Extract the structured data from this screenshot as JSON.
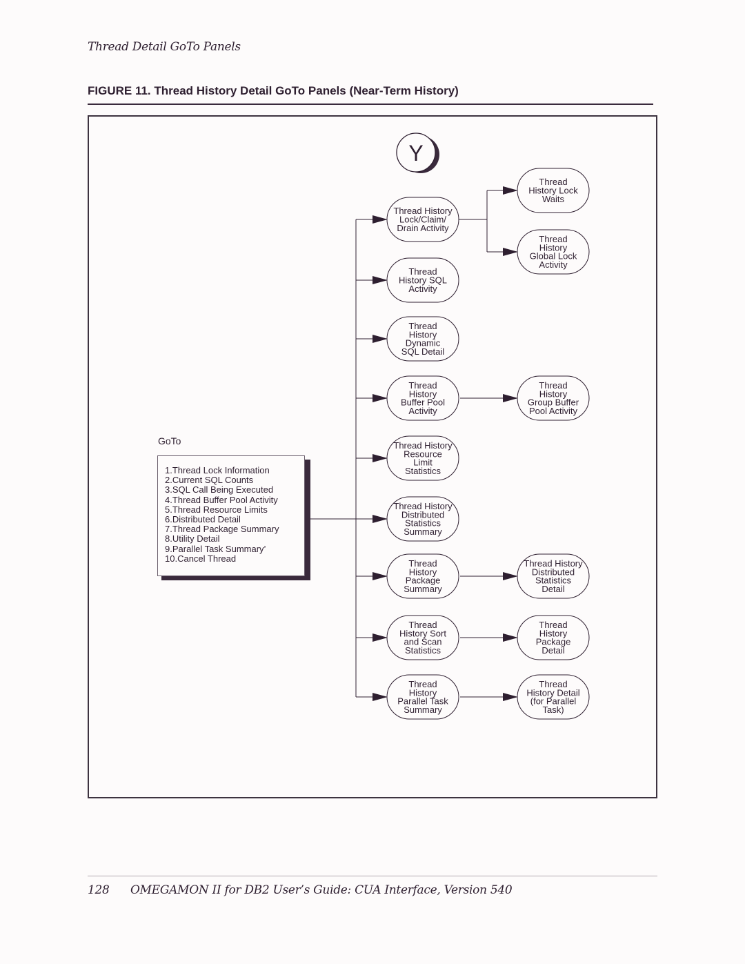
{
  "running_head": "Thread Detail GoTo Panels",
  "figure_title": "FIGURE 11.  Thread History Detail GoTo Panels (Near-Term History)",
  "start_node": {
    "label": "Y"
  },
  "goto_menu": {
    "title": "GoTo",
    "items": [
      {
        "num": "1.",
        "label": "Thread Lock Information"
      },
      {
        "num": "2.",
        "label": "Current SQL Counts"
      },
      {
        "num": "3.",
        "label": "SQL Call Being Executed"
      },
      {
        "num": "4.",
        "label": "Thread Buffer Pool Activity"
      },
      {
        "num": "5.",
        "label": "Thread Resource Limits"
      },
      {
        "num": "6.",
        "label": "Distributed Detail"
      },
      {
        "num": "7.",
        "label": "Thread Package Summary"
      },
      {
        "num": "8.",
        "label": "Utility Detail"
      },
      {
        "num": "9.",
        "label": "Parallel Task Summary’"
      },
      {
        "num": "10.",
        "label": "Cancel Thread"
      }
    ]
  },
  "panels": [
    {
      "id": "lock-claim-drain",
      "lines": [
        "Thread History",
        "Lock/Claim/",
        "Drain Activity"
      ],
      "children": [
        {
          "id": "lock-waits",
          "lines": [
            "Thread",
            "History Lock",
            "Waits"
          ]
        },
        {
          "id": "global-lock",
          "lines": [
            "Thread",
            "History",
            "Global Lock",
            "Activity"
          ]
        }
      ]
    },
    {
      "id": "sql-activity",
      "lines": [
        "Thread",
        "History SQL",
        "Activity"
      ],
      "children": []
    },
    {
      "id": "dynamic-sql",
      "lines": [
        "Thread",
        "History",
        "Dynamic",
        "SQL Detail"
      ],
      "children": []
    },
    {
      "id": "buffer-pool",
      "lines": [
        "Thread",
        "History",
        "Buffer Pool",
        "Activity"
      ],
      "children": [
        {
          "id": "group-buffer-pool",
          "lines": [
            "Thread",
            "History",
            "Group Buffer",
            "Pool Activity"
          ]
        }
      ]
    },
    {
      "id": "resource-limit",
      "lines": [
        "Thread History",
        "Resource",
        "Limit",
        "Statistics"
      ],
      "children": []
    },
    {
      "id": "distributed-summary",
      "lines": [
        "Thread History",
        "Distributed",
        "Statistics",
        "Summary"
      ],
      "children": []
    },
    {
      "id": "package-summary",
      "lines": [
        "Thread",
        "History",
        "Package",
        "Summary"
      ],
      "children": [
        {
          "id": "distributed-detail",
          "lines": [
            "Thread History",
            "Distributed",
            "Statistics",
            "Detail"
          ]
        }
      ]
    },
    {
      "id": "sort-scan",
      "lines": [
        "Thread",
        "History Sort",
        "and Scan",
        "Statistics"
      ],
      "children": [
        {
          "id": "package-detail",
          "lines": [
            "Thread",
            "History",
            "Package",
            "Detail"
          ]
        }
      ]
    },
    {
      "id": "parallel-task-summary",
      "lines": [
        "Thread",
        "History",
        "Parallel Task",
        "Summary"
      ],
      "children": [
        {
          "id": "parallel-detail",
          "lines": [
            "Thread",
            "History Detail",
            "(for Parallel",
            "Task)"
          ]
        }
      ]
    }
  ],
  "footer": {
    "page_number": "128",
    "book_title": "OMEGAMON II for DB2 User’s Guide: CUA Interface, Version 540"
  }
}
